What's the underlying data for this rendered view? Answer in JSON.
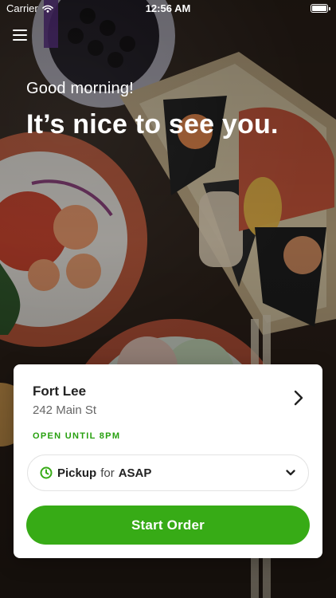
{
  "status_bar": {
    "carrier": "Carrier",
    "time": "12:56 AM"
  },
  "header": {
    "greeting": "Good morning!",
    "headline": "It’s nice to see you."
  },
  "store_card": {
    "store_name": "Fort Lee",
    "address": "242 Main St",
    "hours_status": "OPEN UNTIL 8PM",
    "order_mode": {
      "mode_label": "Pickup",
      "connector": "for",
      "time_label": "ASAP"
    },
    "start_button_label": "Start Order"
  },
  "colors": {
    "accent_green": "#37ab16",
    "status_green": "#27a00f",
    "card_bg": "#ffffff"
  },
  "icons": {
    "menu": "menu-icon",
    "store_chevron": "chevron-right-icon",
    "clock": "clock-icon",
    "dropdown": "chevron-down-icon",
    "wifi": "wifi-icon",
    "battery": "battery-icon"
  }
}
